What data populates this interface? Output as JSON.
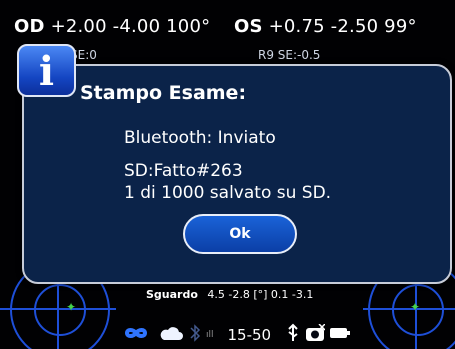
{
  "header": {
    "od_label": "OD",
    "od_values": "+2.00 -4.00 100°",
    "os_label": "OS",
    "os_values": "+0.75 -2.50 99°",
    "od_sub": "SE:0",
    "os_sub": "R9 SE:-0.5"
  },
  "dialog": {
    "title": "Stampo Esame:",
    "line1": "Bluetooth: Inviato",
    "line2": "SD:Fatto#263",
    "line3": "1 di 1000 salvato su SD.",
    "ok_label": "Ok"
  },
  "gaze": {
    "label": "Sguardo",
    "values": "4.5  -2.8 [°] 0.1  -3.1"
  },
  "status": {
    "time": "15-50"
  },
  "colors": {
    "background": "#010103",
    "dialog_bg": "#0b2349",
    "button_blue": "#1a63d8",
    "ring_blue": "#1e4fd8",
    "target_green": "#46d34a"
  },
  "icons": [
    "info-icon",
    "infinity-icon",
    "cloud-icon",
    "bluetooth-icon",
    "usb-icon",
    "camera-icon",
    "battery-icon"
  ]
}
